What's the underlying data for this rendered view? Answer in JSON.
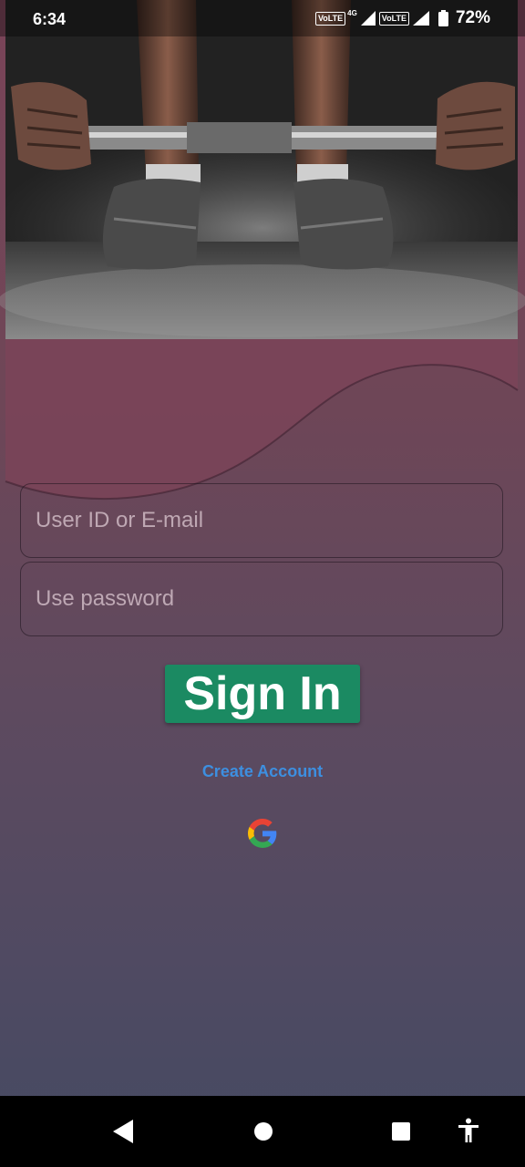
{
  "status_bar": {
    "time": "6:34",
    "volte_1": "VoLTE",
    "network_1": "4G",
    "volte_2": "VoLTE",
    "battery_percent": "72%"
  },
  "login": {
    "user_placeholder": "User ID or E-mail",
    "password_placeholder": "Use password",
    "sign_in_label": "Sign In",
    "create_account_label": "Create Account"
  },
  "icons": {
    "google": "google-g-icon",
    "back": "back-triangle-icon",
    "home": "home-circle-icon",
    "recents": "recents-square-icon",
    "accessibility": "accessibility-person-icon"
  },
  "colors": {
    "sign_in_button": "#1b8a62",
    "create_account_link": "#3d8fe0",
    "background_top": "#7a4458",
    "background_bottom": "#454b63"
  }
}
